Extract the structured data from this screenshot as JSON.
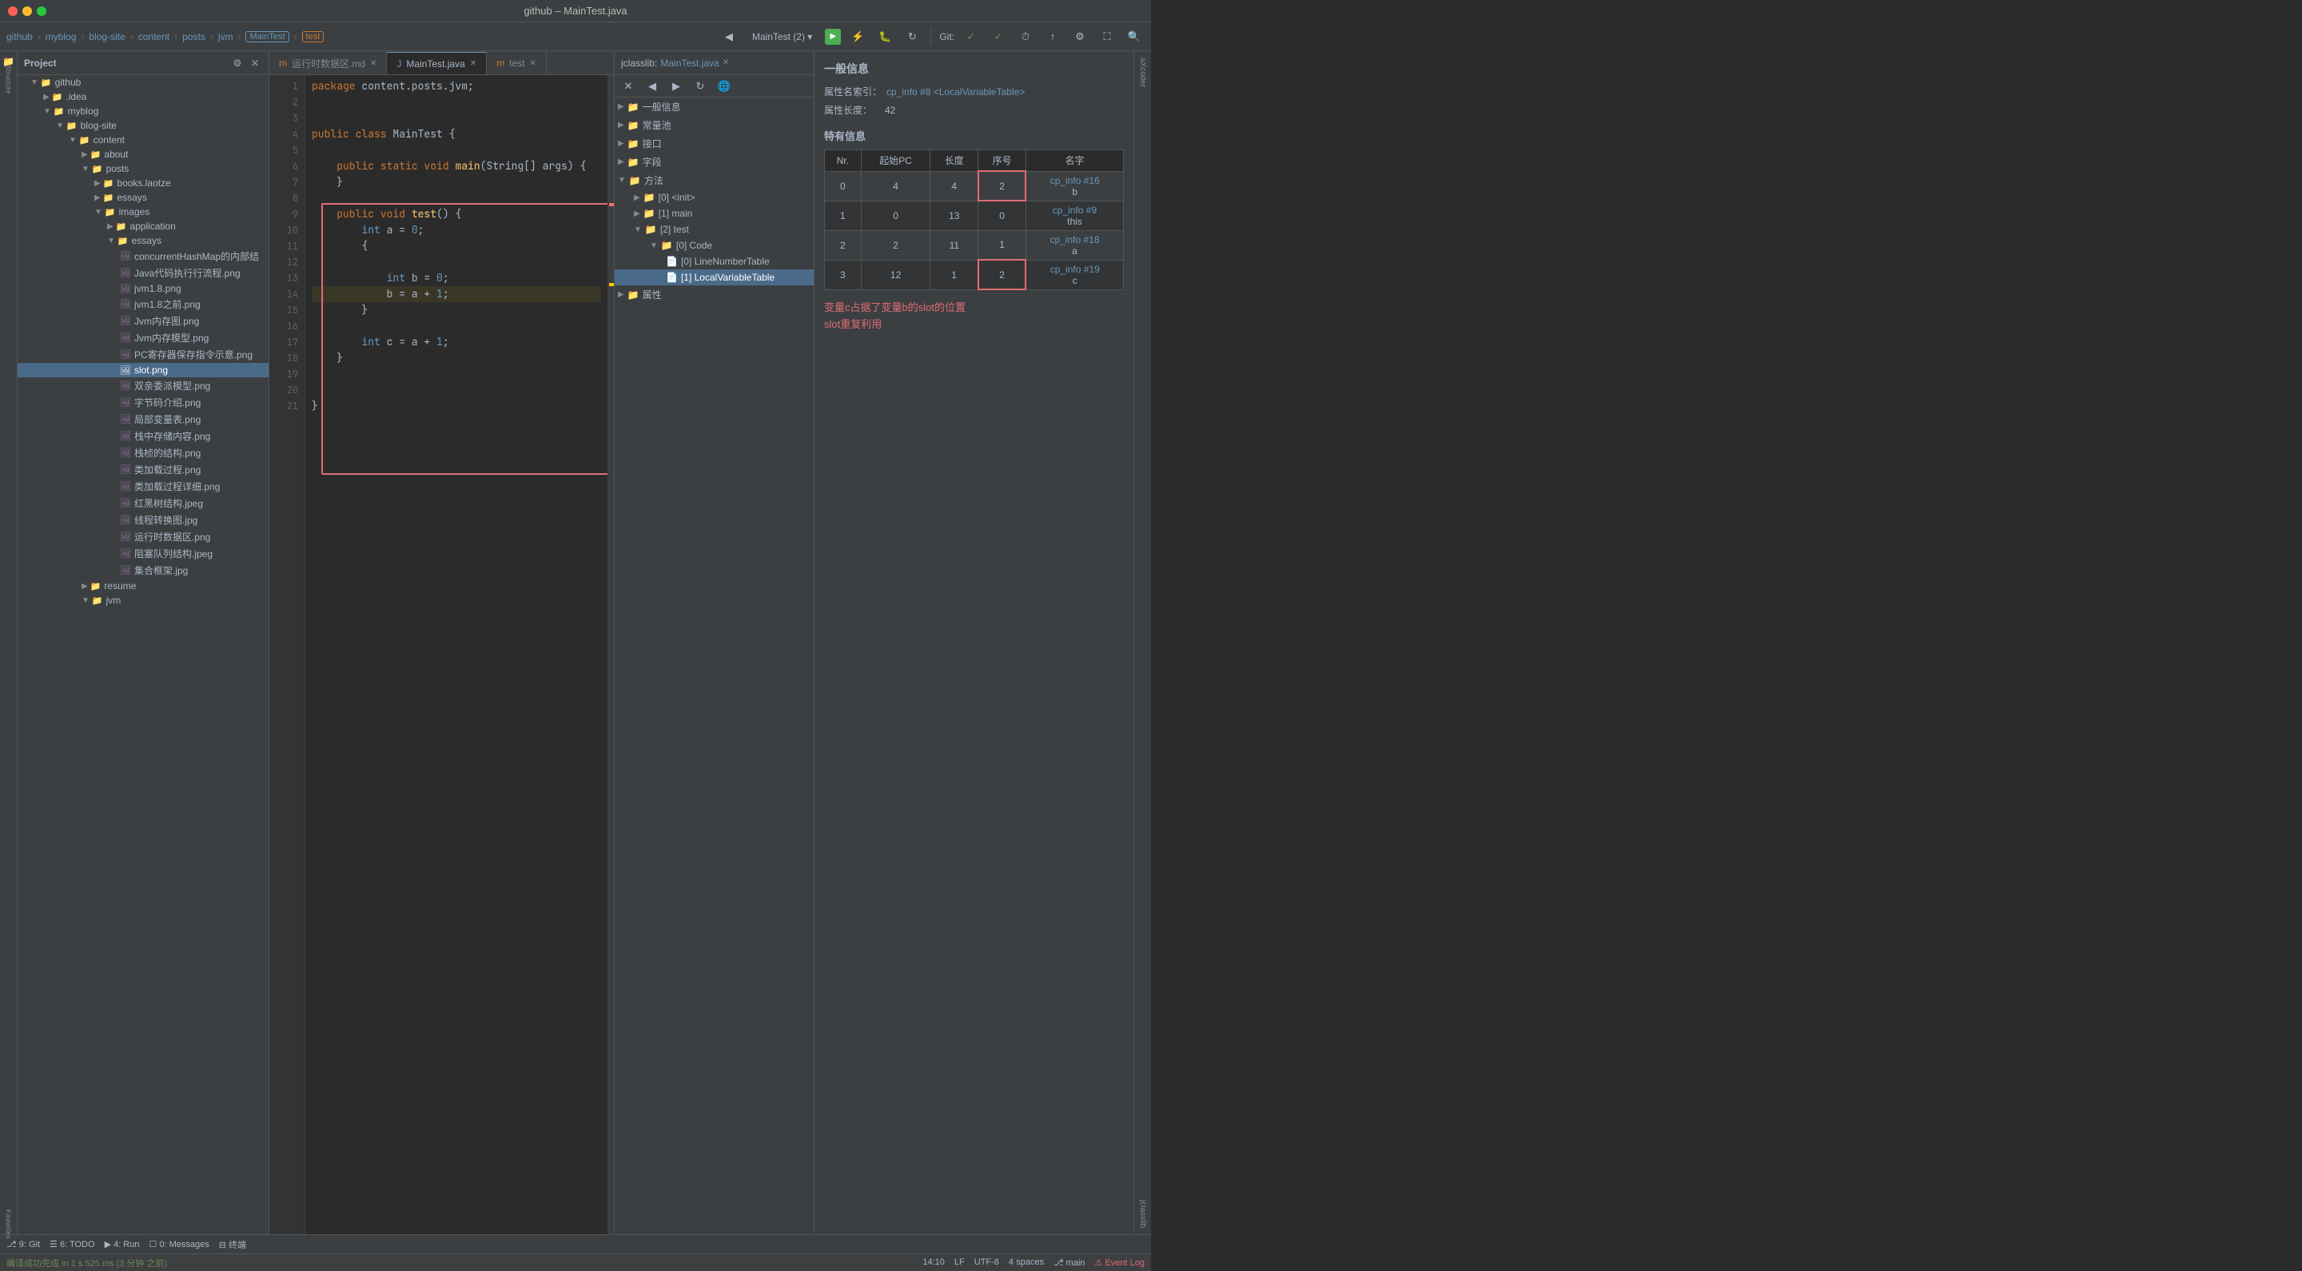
{
  "titlebar": {
    "title": "github – MainTest.java"
  },
  "navbar": {
    "breadcrumb": [
      "github",
      "myblog",
      "blog-site",
      "content",
      "posts",
      "jvm"
    ],
    "active_tab": "MainTest",
    "second_tab": "test",
    "run_config": "MainTest (2)",
    "git_label": "Git:"
  },
  "sidebar": {
    "project_label": "Project",
    "items": [
      {
        "label": "github",
        "type": "root",
        "indent": 0
      },
      {
        "label": ".idea",
        "type": "folder",
        "indent": 1
      },
      {
        "label": "myblog",
        "type": "folder",
        "indent": 1
      },
      {
        "label": "blog-site",
        "type": "folder",
        "indent": 2
      },
      {
        "label": "content",
        "type": "folder",
        "indent": 3
      },
      {
        "label": "about",
        "type": "folder",
        "indent": 4
      },
      {
        "label": "posts",
        "type": "folder",
        "indent": 4
      },
      {
        "label": "books.laotze",
        "type": "folder",
        "indent": 5
      },
      {
        "label": "essays",
        "type": "folder",
        "indent": 5
      },
      {
        "label": "images",
        "type": "folder",
        "indent": 5
      },
      {
        "label": "application",
        "type": "folder",
        "indent": 6
      },
      {
        "label": "essays",
        "type": "folder",
        "indent": 6
      },
      {
        "label": "concurrentHashMap的内部结构",
        "type": "png",
        "indent": 6
      },
      {
        "label": "Java代码执行行流程.png",
        "type": "png",
        "indent": 6
      },
      {
        "label": "jvm1.8.png",
        "type": "png",
        "indent": 6
      },
      {
        "label": "jvm1.8之前.png",
        "type": "png",
        "indent": 6
      },
      {
        "label": "Jvm内存图.png",
        "type": "png",
        "indent": 6
      },
      {
        "label": "Jvm内存模型.png",
        "type": "png",
        "indent": 6
      },
      {
        "label": "PC寄存器保存指令示意.png",
        "type": "png",
        "indent": 6
      },
      {
        "label": "slot.png",
        "type": "png",
        "indent": 6,
        "selected": true
      },
      {
        "label": "双亲委派模型.png",
        "type": "png",
        "indent": 6
      },
      {
        "label": "字节码介绍.png",
        "type": "png",
        "indent": 6
      },
      {
        "label": "局部变量表.png",
        "type": "png",
        "indent": 6
      },
      {
        "label": "栈中存储内容.png",
        "type": "png",
        "indent": 6
      },
      {
        "label": "栈桢的结构.png",
        "type": "png",
        "indent": 6
      },
      {
        "label": "类加载过程.png",
        "type": "png",
        "indent": 6
      },
      {
        "label": "类加载过程详细.png",
        "type": "png",
        "indent": 6
      },
      {
        "label": "红黑树结构.jpeg",
        "type": "png",
        "indent": 6
      },
      {
        "label": "线程转换图.jpg",
        "type": "png",
        "indent": 6
      },
      {
        "label": "运行时数据区.png",
        "type": "png",
        "indent": 6
      },
      {
        "label": "阻塞队列结构.jpeg",
        "type": "png",
        "indent": 6
      },
      {
        "label": "集合框架.jpg",
        "type": "png",
        "indent": 6
      },
      {
        "label": "resume",
        "type": "folder",
        "indent": 4
      },
      {
        "label": "jvm",
        "type": "folder",
        "indent": 4
      }
    ]
  },
  "editor": {
    "tabs": [
      {
        "label": "运行时数据区.md",
        "icon": "md",
        "active": false
      },
      {
        "label": "MainTest.java",
        "icon": "java",
        "active": true
      },
      {
        "label": "test",
        "icon": "java",
        "active": false
      }
    ],
    "code_lines": [
      {
        "num": 1,
        "code": "package content.posts.jvm;",
        "type": "normal"
      },
      {
        "num": 2,
        "code": "",
        "type": "normal"
      },
      {
        "num": 3,
        "code": "",
        "type": "normal"
      },
      {
        "num": 4,
        "code": "public class MainTest {",
        "type": "normal"
      },
      {
        "num": 5,
        "code": "",
        "type": "normal"
      },
      {
        "num": 6,
        "code": "    public static void main(String[] args) {",
        "type": "normal"
      },
      {
        "num": 7,
        "code": "    }",
        "type": "normal"
      },
      {
        "num": 8,
        "code": "",
        "type": "normal"
      },
      {
        "num": 9,
        "code": "    public void test() {",
        "type": "highlight"
      },
      {
        "num": 10,
        "code": "        int a = 0;",
        "type": "highlight"
      },
      {
        "num": 11,
        "code": "        {",
        "type": "highlight"
      },
      {
        "num": 12,
        "code": "",
        "type": "highlight"
      },
      {
        "num": 13,
        "code": "            int b = 0;",
        "type": "highlight"
      },
      {
        "num": 14,
        "code": "            b = a + 1;",
        "type": "highlight"
      },
      {
        "num": 15,
        "code": "        }",
        "type": "highlight"
      },
      {
        "num": 16,
        "code": "",
        "type": "normal"
      },
      {
        "num": 17,
        "code": "        int c = a + 1;",
        "type": "normal"
      },
      {
        "num": 18,
        "code": "    }",
        "type": "normal"
      },
      {
        "num": 19,
        "code": "",
        "type": "normal"
      },
      {
        "num": 20,
        "code": "",
        "type": "normal"
      },
      {
        "num": 21,
        "code": "}",
        "type": "normal"
      }
    ]
  },
  "jclasslib": {
    "title": "jclasslib:",
    "file": "MainTest.java",
    "tree": [
      {
        "label": "一般信息",
        "type": "folder",
        "indent": 0
      },
      {
        "label": "常量池",
        "type": "folder",
        "indent": 0
      },
      {
        "label": "接口",
        "type": "folder",
        "indent": 0
      },
      {
        "label": "字段",
        "type": "folder",
        "indent": 0
      },
      {
        "label": "方法",
        "type": "folder",
        "indent": 0,
        "expanded": true
      },
      {
        "label": "[0] <init>",
        "type": "folder",
        "indent": 1
      },
      {
        "label": "[1] main",
        "type": "folder",
        "indent": 1
      },
      {
        "label": "[2] test",
        "type": "folder",
        "indent": 1,
        "expanded": true
      },
      {
        "label": "[0] Code",
        "type": "folder",
        "indent": 2,
        "expanded": true
      },
      {
        "label": "[0] LineNumberTable",
        "type": "item",
        "indent": 3
      },
      {
        "label": "[1] LocalVariableTable",
        "type": "item",
        "indent": 3,
        "selected": true
      },
      {
        "label": "属性",
        "type": "folder",
        "indent": 0
      }
    ]
  },
  "info_panel": {
    "title": "一般信息",
    "attr_name_label": "属性名索引：",
    "attr_name_value": "cp_info #8",
    "attr_name_link": "<LocalVariableTable>",
    "attr_length_label": "属性长度：",
    "attr_length_value": "42",
    "special_info_label": "特有信息",
    "table_headers": [
      "Nr.",
      "起始PC",
      "长度",
      "序号",
      "名字"
    ],
    "table_rows": [
      {
        "nr": "0",
        "start_pc": "4",
        "length": "4",
        "seq": "2",
        "name_link": "cp_info #16",
        "name_var": "b",
        "highlighted": true
      },
      {
        "nr": "1",
        "start_pc": "0",
        "length": "13",
        "seq": "0",
        "name_link": "cp_info #9",
        "name_var": "this",
        "highlighted": false
      },
      {
        "nr": "2",
        "start_pc": "2",
        "length": "11",
        "seq": "1",
        "name_link": "cp_info #18",
        "name_var": "a",
        "highlighted": false
      },
      {
        "nr": "3",
        "start_pc": "12",
        "length": "1",
        "seq": "2",
        "name_link": "cp_info #19",
        "name_var": "c",
        "highlighted": true
      }
    ],
    "red_note": "变量c占据了变量b的slot的位置\nslot重复利用"
  },
  "bottom_bar": {
    "git_icon": "git",
    "git_label": "9: Git",
    "todo_label": "6: TODO",
    "run_label": "4: Run",
    "messages_label": "0: Messages",
    "terminal_label": "终端"
  },
  "status_bar": {
    "message": "编译成功完成 in 1 s 525 ms (3 分钟 之前)",
    "time": "14:10",
    "line_sep": "LF",
    "encoding": "UTF-8",
    "indent": "4 spaces",
    "branch": "main"
  }
}
